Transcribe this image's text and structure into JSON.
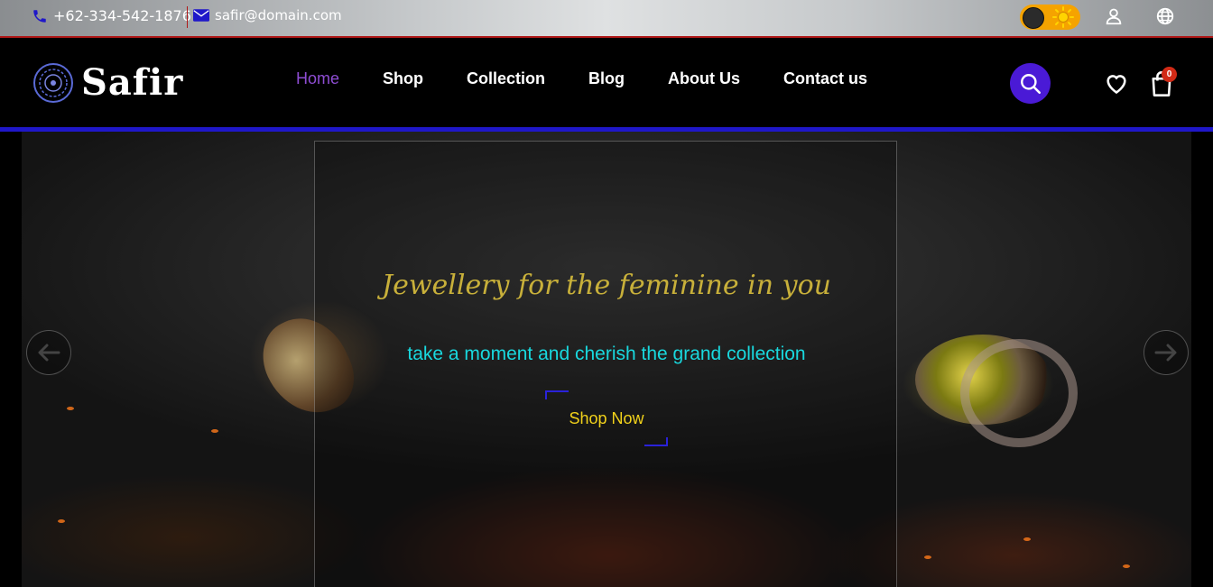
{
  "topbar": {
    "phone": "+62-334-542-1876",
    "email": "safir@domain.com",
    "theme_toggle_colors": {
      "track": "#f5a300",
      "knob": "#2b2b2b"
    },
    "icons": [
      "phone-icon",
      "mail-icon",
      "sun-icon",
      "user-icon",
      "globe-icon"
    ]
  },
  "header": {
    "brand": "Safir",
    "nav": [
      {
        "label": "Home",
        "active": true
      },
      {
        "label": "Shop",
        "active": false
      },
      {
        "label": "Collection",
        "active": false
      },
      {
        "label": "Blog",
        "active": false
      },
      {
        "label": "About Us",
        "active": false
      },
      {
        "label": "Contact us",
        "active": false
      }
    ],
    "cart_count": "0",
    "accent_color": "#4a1ad6",
    "underline_color": "#1f17c9"
  },
  "hero": {
    "tagline": "Jewellery for the feminine in you",
    "subline": "take a moment and cherish the grand collection",
    "cta_label": "Shop Now",
    "tagline_color": "#c8b03a",
    "subline_color": "#19d8de",
    "cta_color": "#f2d21a"
  }
}
